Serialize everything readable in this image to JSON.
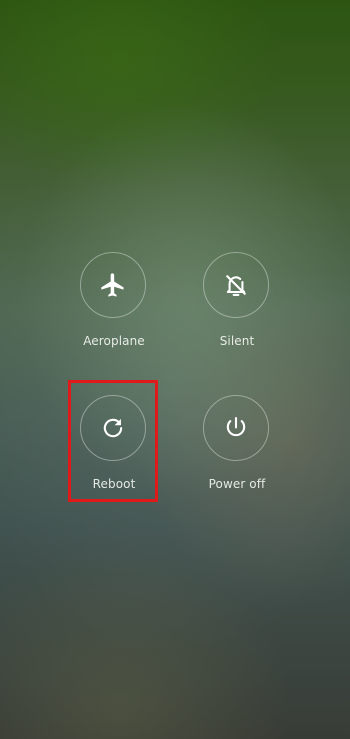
{
  "power_menu": {
    "actions": [
      {
        "label": "Aeroplane",
        "icon": "airplane-icon"
      },
      {
        "label": "Silent",
        "icon": "bell-off-icon"
      },
      {
        "label": "Reboot",
        "icon": "reboot-icon"
      },
      {
        "label": "Power off",
        "icon": "power-icon"
      }
    ]
  },
  "highlight": {
    "target": "Reboot",
    "color": "#e01a1a"
  },
  "colors": {
    "background_top": "#2d5512",
    "background_bottom": "#383c36",
    "icon": "#ffffff",
    "label": "#f2f4ef"
  }
}
